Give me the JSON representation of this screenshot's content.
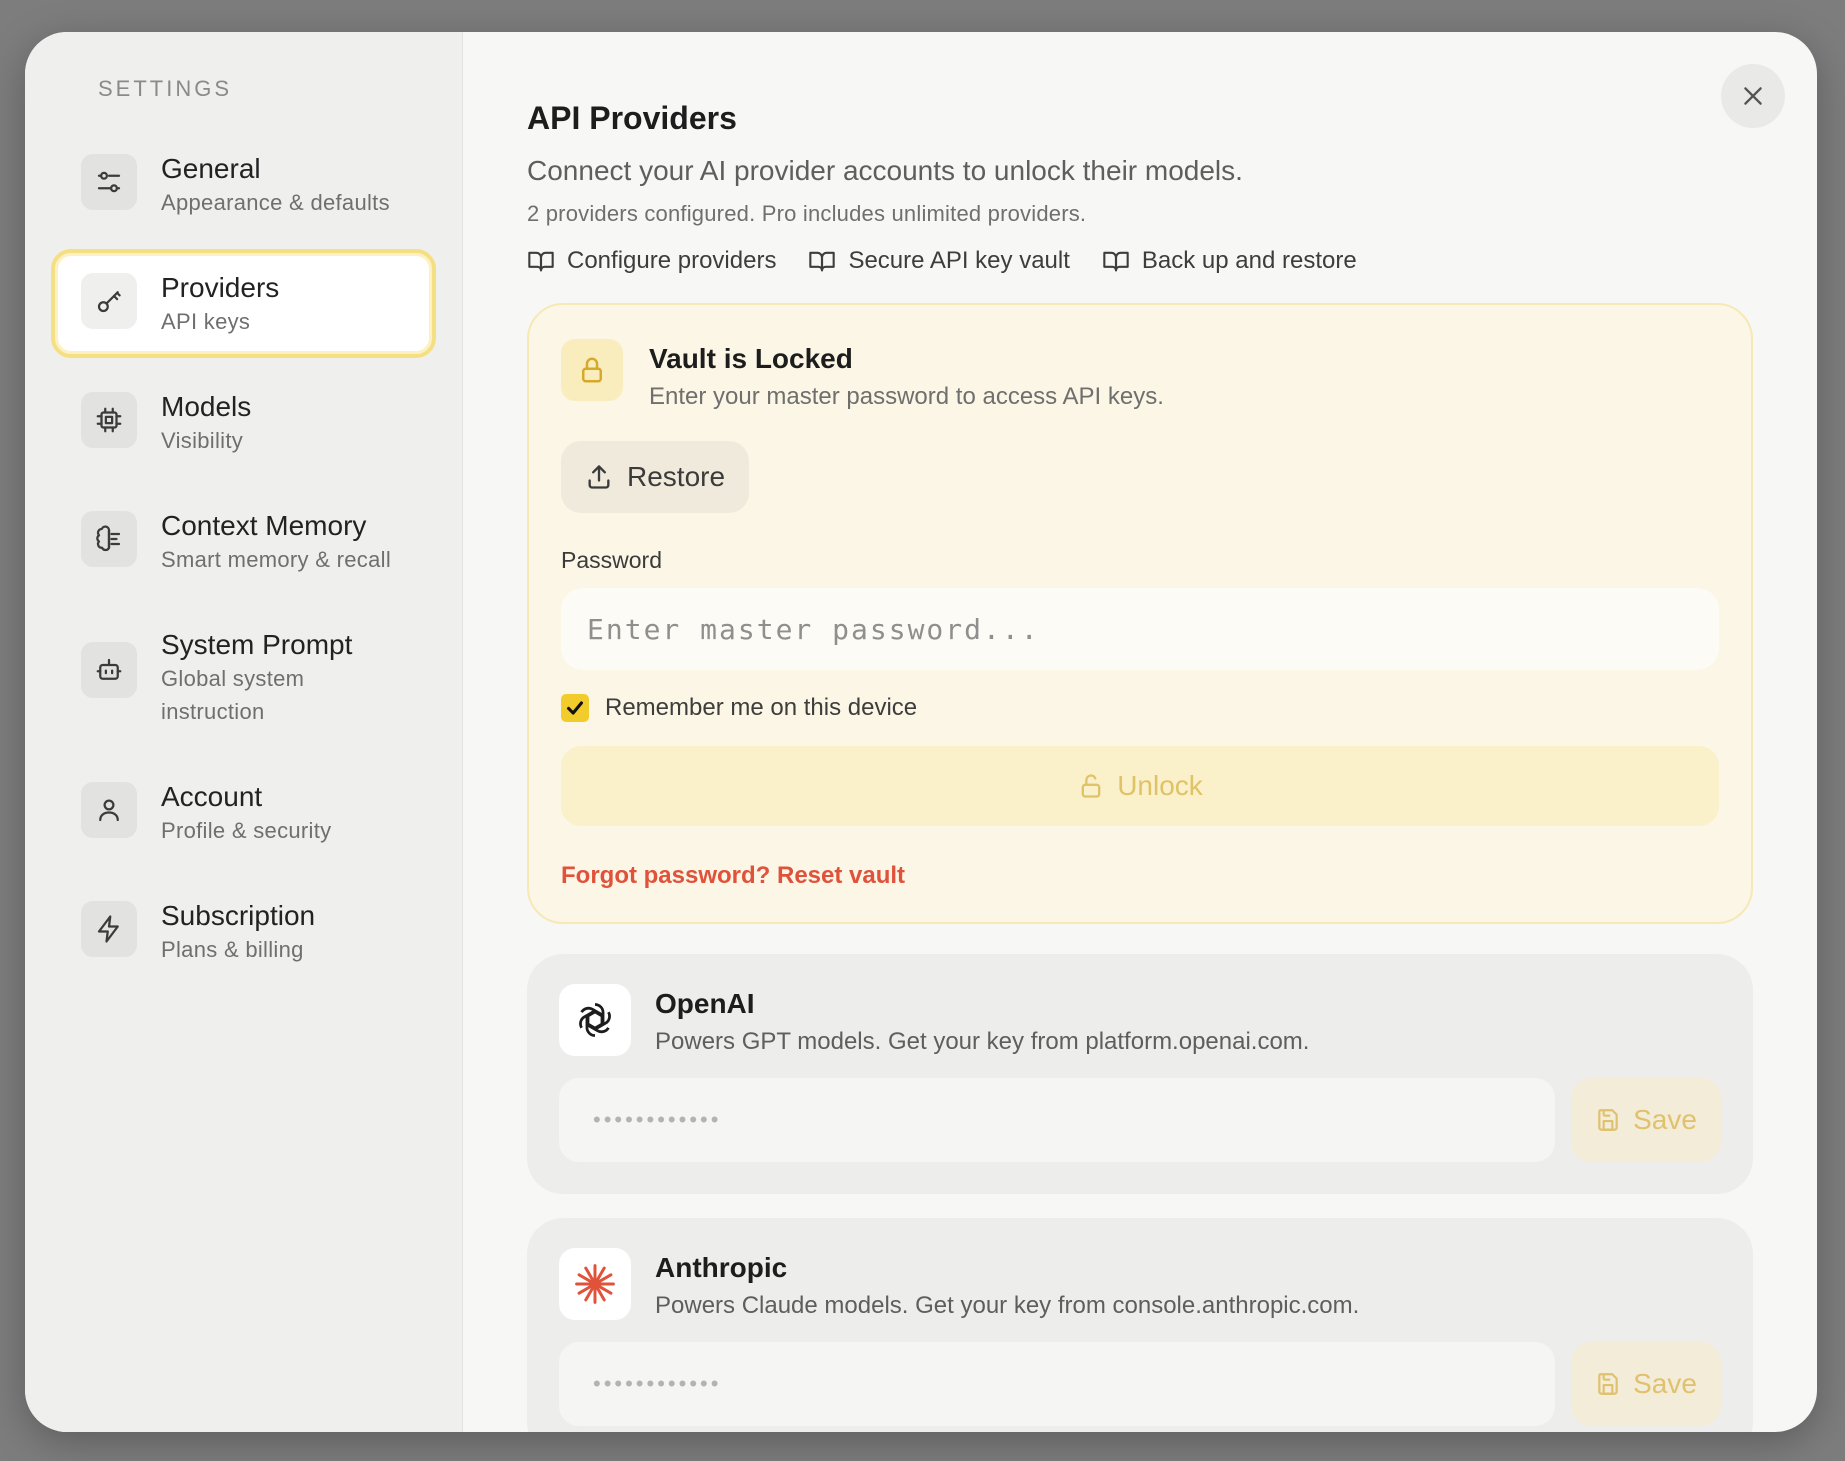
{
  "sidebar": {
    "heading": "SETTINGS",
    "items": [
      {
        "title": "General",
        "subtitle": "Appearance & defaults",
        "icon": "sliders-icon"
      },
      {
        "title": "Providers",
        "subtitle": "API keys",
        "icon": "key-icon",
        "active": true
      },
      {
        "title": "Models",
        "subtitle": "Visibility",
        "icon": "chip-icon"
      },
      {
        "title": "Context Memory",
        "subtitle": "Smart memory & recall",
        "icon": "brain-icon"
      },
      {
        "title": "System Prompt",
        "subtitle": "Global system instruction",
        "icon": "bot-icon"
      },
      {
        "title": "Account",
        "subtitle": "Profile & security",
        "icon": "user-icon"
      },
      {
        "title": "Subscription",
        "subtitle": "Plans & billing",
        "icon": "bolt-icon"
      }
    ]
  },
  "main": {
    "title": "API Providers",
    "description": "Connect your AI provider accounts to unlock their models.",
    "count_text": "2 providers configured. Pro includes unlimited providers.",
    "doc_links": [
      "Configure providers",
      "Secure API key vault",
      "Back up and restore"
    ]
  },
  "vault": {
    "title": "Vault is Locked",
    "subtitle": "Enter your master password to access API keys.",
    "restore_label": "Restore",
    "password_label": "Password",
    "password_placeholder": "Enter master password...",
    "remember_label": "Remember me on this device",
    "remember_checked": true,
    "unlock_label": "Unlock",
    "reset_link": "Forgot password? Reset vault"
  },
  "providers": [
    {
      "name": "OpenAI",
      "description": "Powers GPT models. Get your key from platform.openai.com.",
      "key_placeholder": "••••••••••••",
      "save_label": "Save",
      "icon": "openai-logo-icon"
    },
    {
      "name": "Anthropic",
      "description": "Powers Claude models. Get your key from console.anthropic.com.",
      "key_placeholder": "••••••••••••",
      "save_label": "Save",
      "icon": "anthropic-logo-icon"
    }
  ],
  "colors": {
    "accent": "#f2cc2a",
    "accent_border": "#f5df83",
    "danger_link": "#e0523a",
    "anthropic_brand": "#e0523a"
  }
}
